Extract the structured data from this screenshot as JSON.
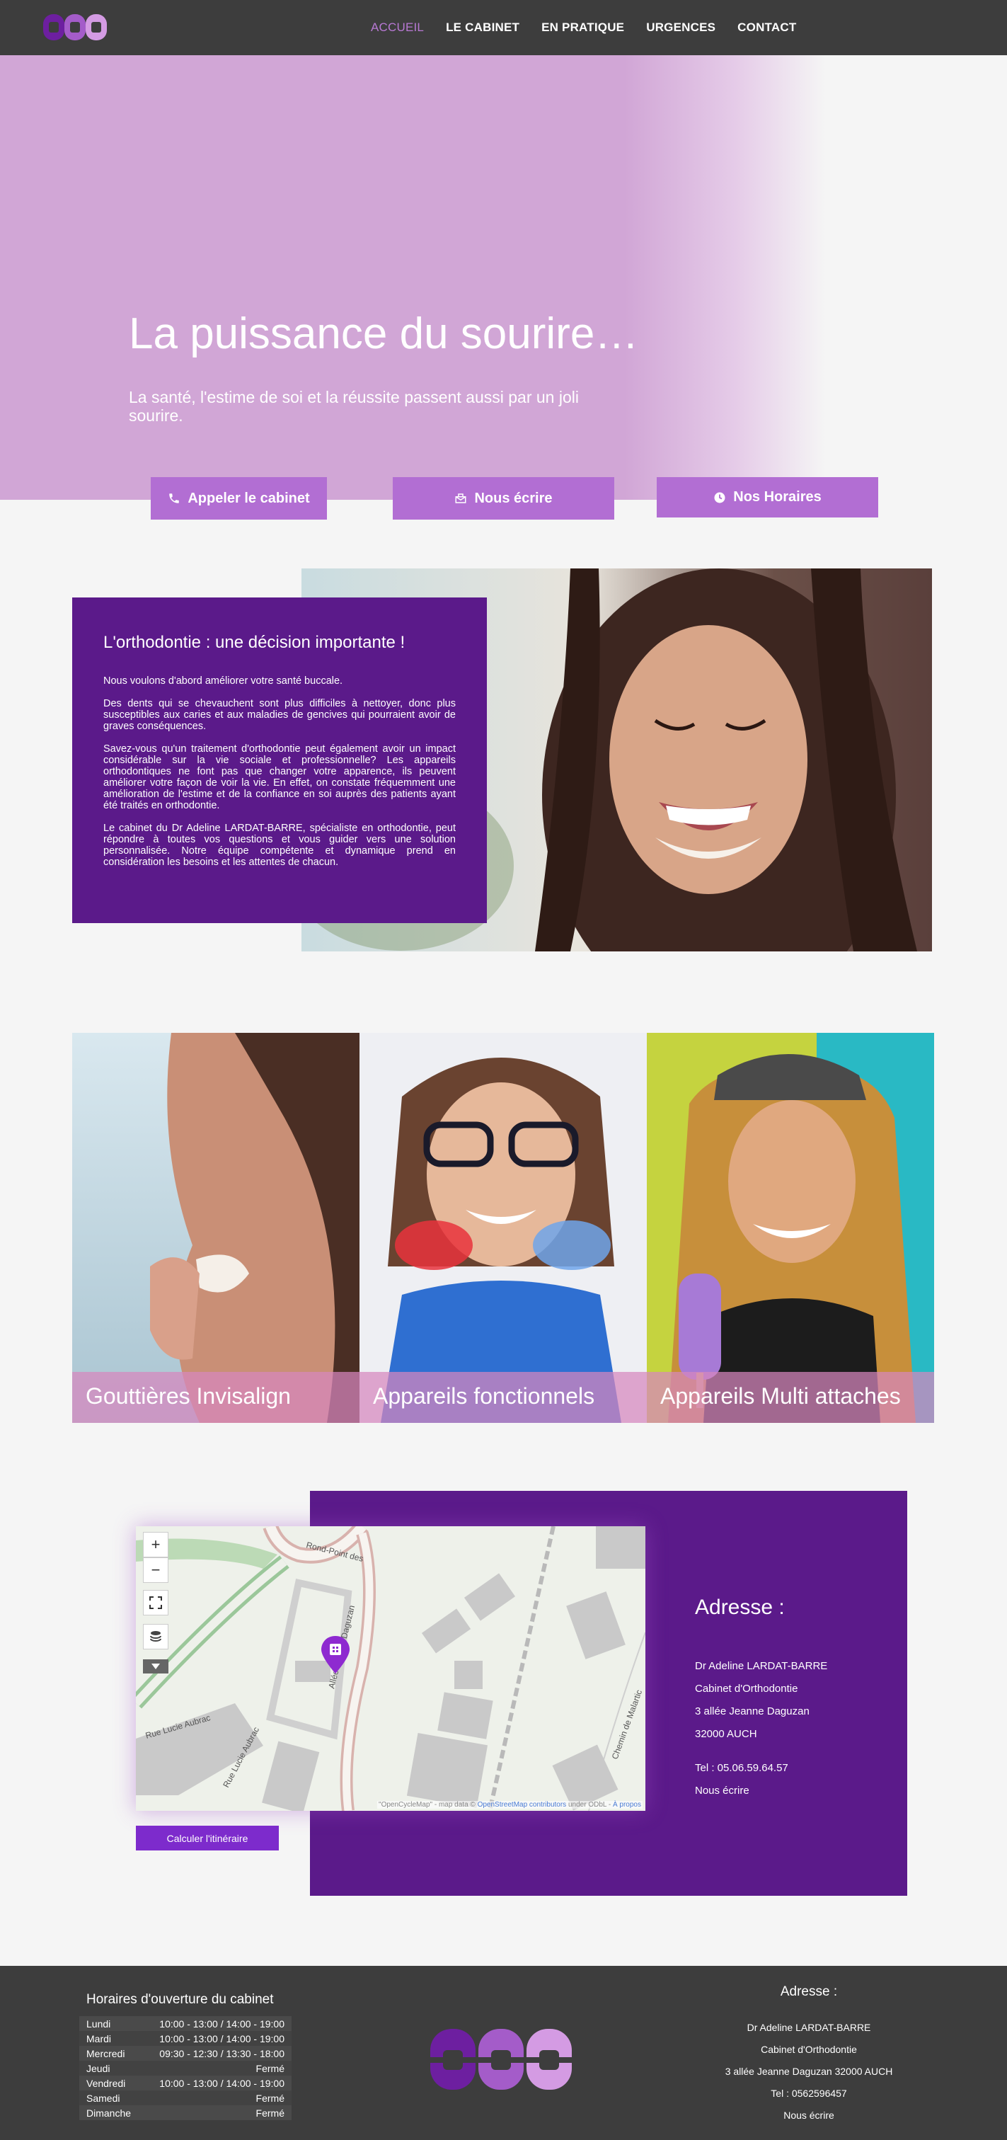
{
  "nav": {
    "items": [
      {
        "label": "ACCUEIL",
        "active": true
      },
      {
        "label": "LE CABINET"
      },
      {
        "label": "EN PRATIQUE"
      },
      {
        "label": "URGENCES"
      },
      {
        "label": "CONTACT"
      }
    ]
  },
  "hero": {
    "title": "La puissance du sourire…",
    "subtitle": "La santé, l'estime de soi et la réussite passent aussi par un joli sourire.",
    "buttons": {
      "call": "Appeler le cabinet",
      "write": "Nous écrire",
      "hours": "Nos Horaires"
    }
  },
  "ortho": {
    "title": "L'orthodontie : une décision importante !",
    "p1": "Nous voulons d'abord améliorer votre santé buccale.",
    "p2": "Des dents qui se chevauchent sont plus difficiles à nettoyer, donc plus susceptibles aux caries et aux maladies de gencives qui pourraient avoir de graves conséquences.",
    "p3": "Savez-vous qu'un traitement d'orthodontie peut également avoir un impact considérable sur la vie sociale et professionnelle? Les appareils orthodontiques ne font pas que changer votre apparence, ils peuvent améliorer votre façon de voir la vie. En effet, on constate fréquemment une amélioration de l'estime et de la confiance en soi auprès des patients ayant été traités en orthodontie.",
    "p4": "Le cabinet du Dr Adeline LARDAT-BARRE, spécialiste en orthodontie, peut répondre à toutes vos questions et vous guider vers une solution personnalisée. Notre équipe compétente et dynamique prend en considération les besoins et les attentes de chacun."
  },
  "treatments": [
    {
      "label": "Gouttières Invisalign"
    },
    {
      "label": "Appareils fonctionnels"
    },
    {
      "label": "Appareils Multi attaches"
    }
  ],
  "map": {
    "zoom_in": "+",
    "zoom_out": "−",
    "streets": [
      "Rond-Point des",
      "Allée Jeanne Daguzan",
      "Rue Lucie Aubrac",
      "Rue Lucie Aubrac",
      "Chemin de Malartic"
    ],
    "attribution_text": "\"OpenCycleMap\" - map data © ",
    "attribution_link1": "OpenStreetMap contributors",
    "attribution_mid": " under ODbL - ",
    "attribution_link2": "À propos",
    "itinerary_button": "Calculer l'itinéraire"
  },
  "address": {
    "title": "Adresse :",
    "name": "Dr Adeline LARDAT-BARRE",
    "role": "Cabinet d'Orthodontie",
    "street": "3 allée Jeanne Daguzan",
    "city": "32000 AUCH",
    "phone": "Tel : 05.06.59.64.57",
    "write": "Nous écrire"
  },
  "footer": {
    "hours_title": "Horaires d'ouverture du cabinet",
    "hours": [
      {
        "day": "Lundi",
        "time": "10:00 - 13:00 / 14:00 - 19:00"
      },
      {
        "day": "Mardi",
        "time": "10:00 - 13:00 / 14:00 - 19:00"
      },
      {
        "day": "Mercredi",
        "time": "09:30 - 12:30 / 13:30 - 18:00"
      },
      {
        "day": "Jeudi",
        "time": "Fermé"
      },
      {
        "day": "Vendredi",
        "time": "10:00 - 13:00 / 14:00 - 19:00"
      },
      {
        "day": "Samedi",
        "time": "Fermé"
      },
      {
        "day": "Dimanche",
        "time": "Fermé"
      }
    ],
    "address_title": "Adresse :",
    "name": "Dr Adeline LARDAT-BARRE",
    "role": "Cabinet d'Orthodontie",
    "street": "3 allée Jeanne Daguzan 32000 AUCH",
    "phone": "Tel : 0562596457",
    "write": "Nous écrire"
  },
  "colors": {
    "brand_dark": "#5b1a8a",
    "brand_mid": "#b26ed3",
    "brand_light": "#d1a6d6",
    "nav_bg": "#3d3d3d"
  },
  "icons": [
    "logo-rings",
    "phone-icon",
    "mail-icon",
    "clock-icon",
    "zoom-in-icon",
    "zoom-out-icon",
    "fullscreen-icon",
    "layers-icon",
    "collapse-icon",
    "map-marker-icon"
  ]
}
